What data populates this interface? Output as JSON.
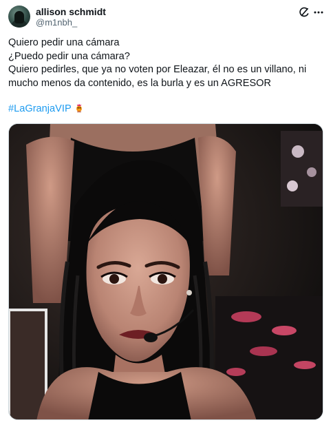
{
  "author": {
    "display_name": "allison schmidt",
    "handle": "@m1nbh_",
    "avatar_icon": "profile-photo"
  },
  "actions": {
    "grok_icon": "grok-icon",
    "more_icon": "more-options-icon"
  },
  "post": {
    "lines": [
      "Quiero pedir una cámara",
      "¿Puedo pedir una cámara?",
      "Quiero pedirles, que ya no voten por Eleazar, él no es un villano, ni mucho menos da contenido, es la burla y es un AGRESOR"
    ],
    "hashtag": "#LaGranjaVIP",
    "hashtag_emoji": "rooster-emoji"
  },
  "media": {
    "type": "photo",
    "description_icon": "photo"
  },
  "colors": {
    "text": "#0f1419",
    "secondary_text": "#536471",
    "link": "#1d9bf0",
    "border": "#cfd9de"
  }
}
